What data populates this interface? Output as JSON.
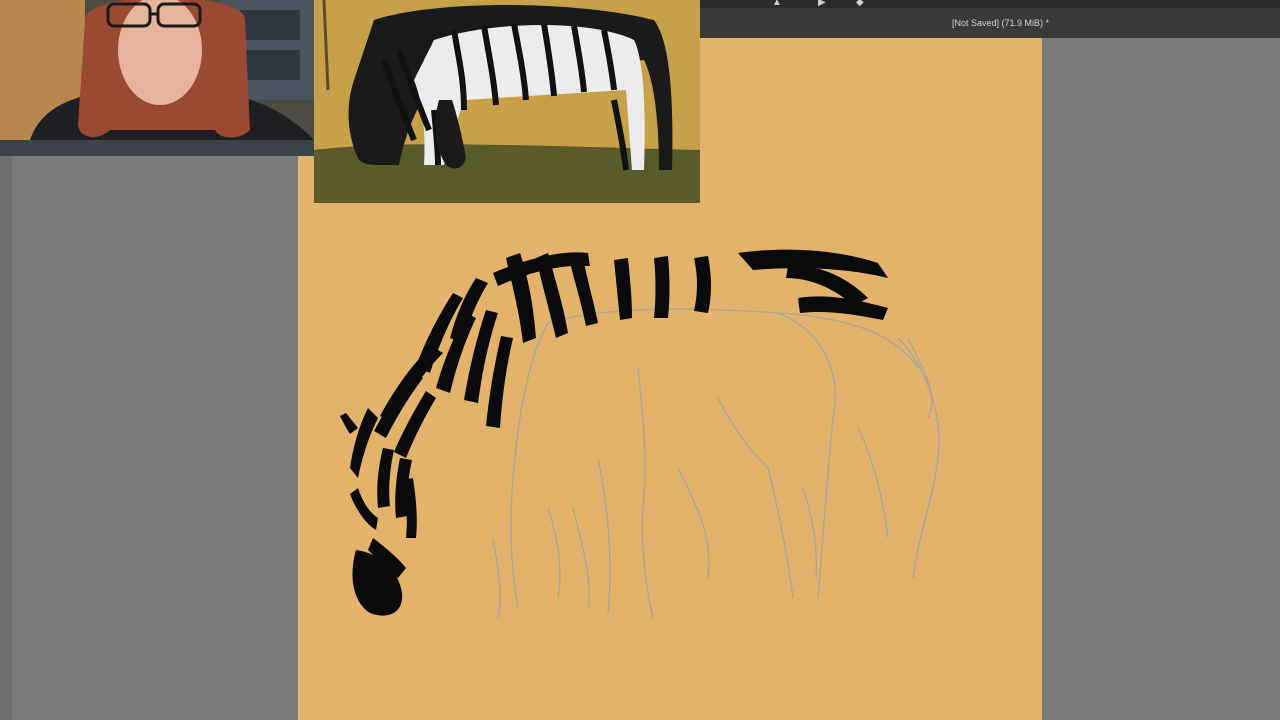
{
  "app": {
    "document_status": "[Not Saved]  (71.9 MiB) *"
  },
  "toolbar": {
    "icons": [
      "move-tool-icon",
      "transform-tool-icon",
      "eraser-tool-icon"
    ]
  },
  "canvas": {
    "background_color": "#e3b36b",
    "stroke_color": "#0a0a0a",
    "sketch_color": "#9aa3a8"
  },
  "workspace": {
    "background_color": "#7b7b7b"
  }
}
